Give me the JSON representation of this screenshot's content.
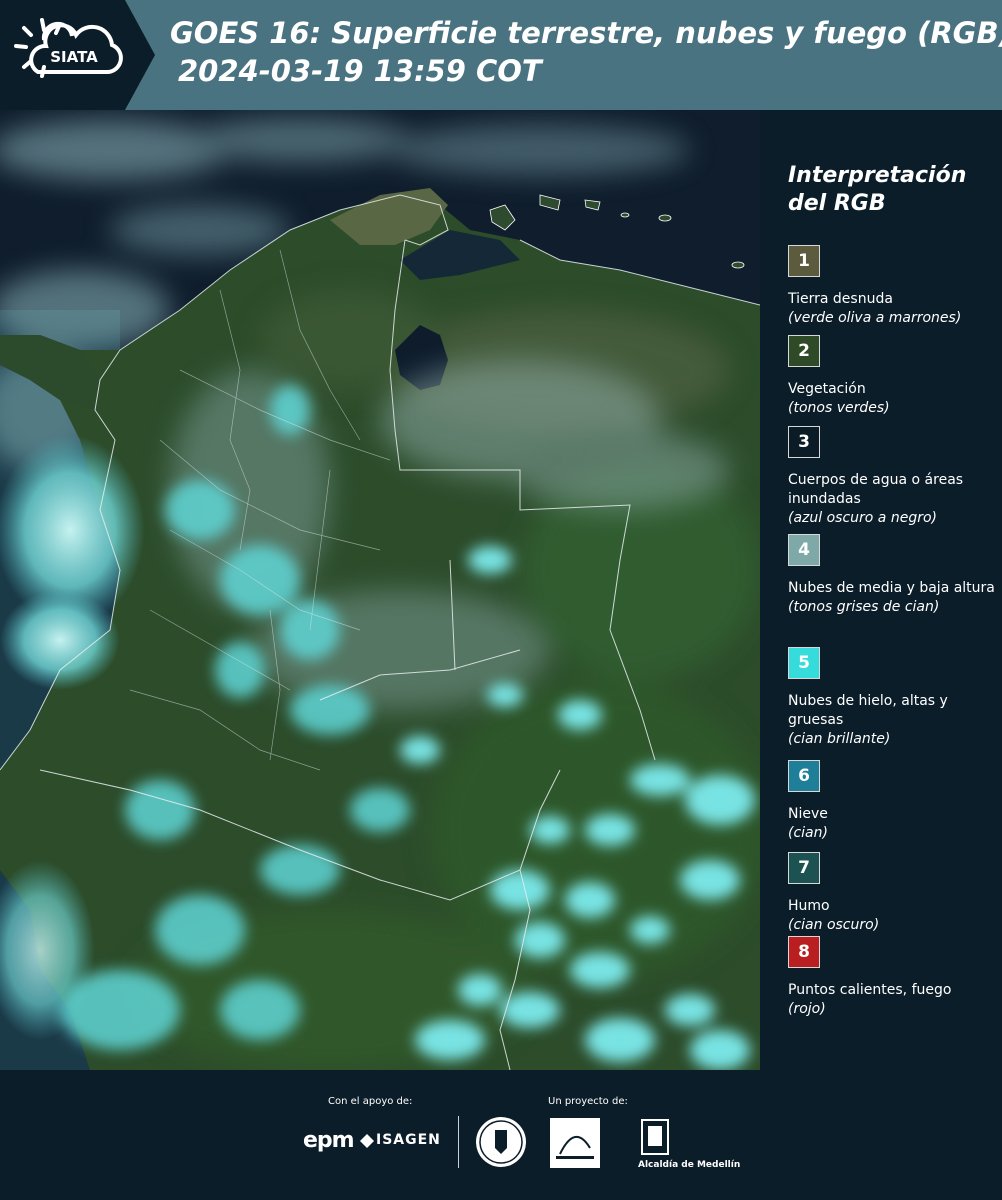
{
  "header": {
    "logo_text": "SIATA",
    "title": "GOES 16: Superficie terrestre, nubes y fuego (RGB)",
    "subtitle": "2024-03-19 13:59 COT"
  },
  "legend": {
    "title": "Interpretación del RGB",
    "items": [
      {
        "number": "1",
        "color": "#5d5b3e",
        "label": "Tierra desnuda",
        "note": "(verde oliva a marrones)"
      },
      {
        "number": "2",
        "color": "#2f4a26",
        "label": "Vegetación",
        "note": "(tonos verdes)"
      },
      {
        "number": "3",
        "color": "#0c1c27",
        "label": "Cuerpos de agua o áreas inundadas",
        "note": "(azul oscuro a negro)"
      },
      {
        "number": "4",
        "color": "#7fa9a8",
        "label": "Nubes de media y baja altura",
        "note": "(tonos grises de cian)"
      },
      {
        "number": "5",
        "color": "#36dcdc",
        "label": "Nubes de hielo, altas y gruesas",
        "note": "(cian brillante)"
      },
      {
        "number": "6",
        "color": "#1f7e98",
        "label": "Nieve",
        "note": "(cian)"
      },
      {
        "number": "7",
        "color": "#1d5253",
        "label": "Humo",
        "note": "(cian oscuro)"
      },
      {
        "number": "8",
        "color": "#b91f20",
        "label": "Puntos calientes, fuego",
        "note": "(rojo)"
      }
    ]
  },
  "footer": {
    "support_label": "Con el apoyo de:",
    "project_label": "Un proyecto de:",
    "epm": "epm",
    "isagen": "ISAGEN",
    "alcaldia": "Alcaldía de Medellín"
  }
}
